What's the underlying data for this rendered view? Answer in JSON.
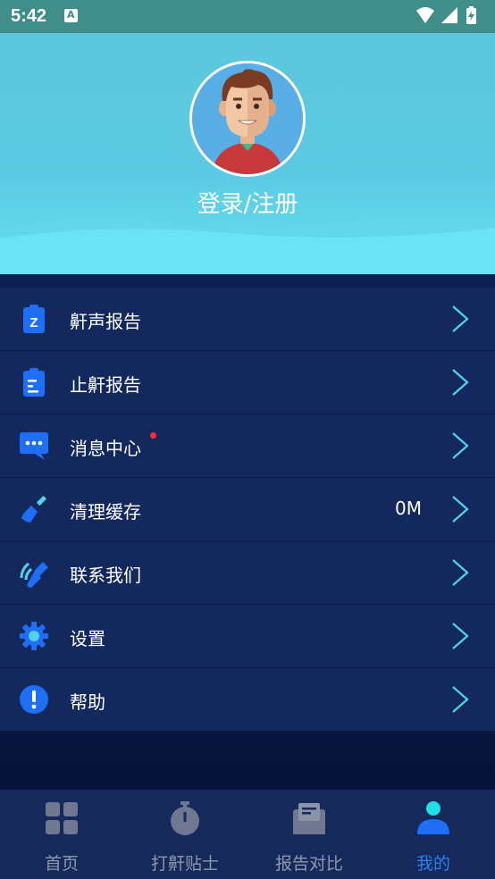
{
  "status_bar": {
    "time": "5:42"
  },
  "profile": {
    "login_text": "登录/注册"
  },
  "menu": {
    "items": [
      {
        "label": "鼾声报告",
        "icon": "snore-report-icon"
      },
      {
        "label": "止鼾报告",
        "icon": "stop-snore-report-icon"
      },
      {
        "label": "消息中心",
        "icon": "message-icon",
        "badge": "unread"
      },
      {
        "label": "清理缓存",
        "icon": "broom-icon",
        "value": "0M"
      },
      {
        "label": "联系我们",
        "icon": "phone-icon"
      },
      {
        "label": "设置",
        "icon": "gear-icon"
      },
      {
        "label": "帮助",
        "icon": "help-icon"
      }
    ]
  },
  "bottom_nav": {
    "tabs": [
      {
        "label": "首页",
        "icon": "grid-icon"
      },
      {
        "label": "打鼾贴士",
        "icon": "stopwatch-icon"
      },
      {
        "label": "报告对比",
        "icon": "envelope-icon"
      },
      {
        "label": "我的",
        "icon": "person-icon",
        "active": true
      }
    ]
  },
  "colors": {
    "accent": "#2e7ff2",
    "chevron": "#4fd3ee",
    "header": "#5bcbe3",
    "menu_bg": "#13295e",
    "badge": "#ff2a2a"
  }
}
